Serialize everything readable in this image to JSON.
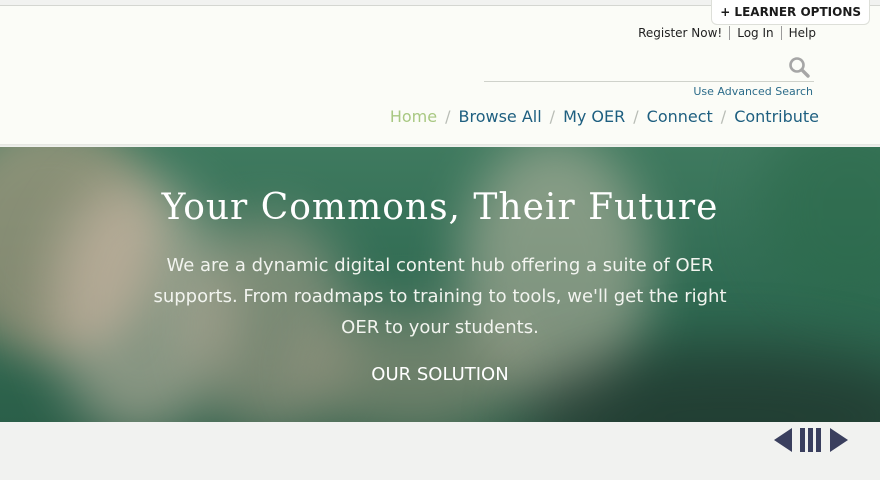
{
  "learner_options": "+ LEARNER OPTIONS",
  "utility_links": {
    "register": "Register Now!",
    "login": "Log In",
    "help": "Help"
  },
  "search": {
    "placeholder": "",
    "value": "",
    "advanced_label": "Use Advanced Search"
  },
  "nav": {
    "home": "Home",
    "browse_all": "Browse All",
    "my_oer": "My OER",
    "connect": "Connect",
    "contribute": "Contribute",
    "separator": "/",
    "active": "Home"
  },
  "hero": {
    "title": "Your Commons, Their Future",
    "description": "We are a dynamic digital content hub offering a suite of OER supports. From roadmaps to training to tools, we'll get the right OER to your students.",
    "cta": "OUR SOLUTION"
  },
  "slider": {
    "icons": [
      "chevron-left-icon",
      "pause-icon",
      "chevron-right-icon"
    ]
  },
  "colors": {
    "nav_link": "#1e5f80",
    "nav_active": "#a8c882",
    "hero_green": "#3a7559",
    "control": "#3a3f5e"
  }
}
